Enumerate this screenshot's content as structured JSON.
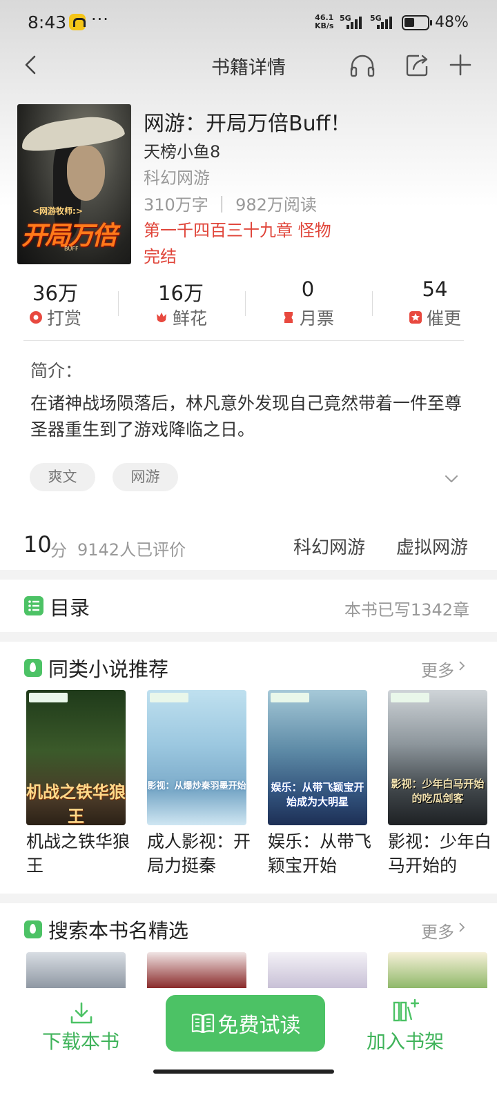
{
  "status_bar": {
    "time": "8:43",
    "more": "···",
    "speed": "46.1",
    "speed_unit": "KB/s",
    "signal1": "5G",
    "signal2": "5G",
    "battery": "48%"
  },
  "nav": {
    "title": "书籍详情",
    "icons": [
      "back-icon",
      "headphones-icon",
      "share-icon",
      "add-icon"
    ]
  },
  "book": {
    "cover_subtitle": "<网游牧师:>",
    "cover_title": "开局万倍",
    "cover_tag": "BUFF",
    "title": "网游：开局万倍Buff！",
    "author": "天榜小鱼8",
    "category": "科幻网游",
    "meta": "310万字 ｜ 982万阅读",
    "latest_chapter": "第一千四百三十九章 怪物",
    "status": "完结"
  },
  "stats": [
    {
      "value": "36万",
      "label": "打赏",
      "icon": "reward-icon"
    },
    {
      "value": "16万",
      "label": "鲜花",
      "icon": "flower-icon"
    },
    {
      "value": "0",
      "label": "月票",
      "icon": "ticket-icon"
    },
    {
      "value": "54",
      "label": "催更",
      "icon": "urge-icon"
    }
  ],
  "intro": {
    "label": "简介：",
    "text": "在诸神战场陨落后，林凡意外发现自己竟然带着一件至尊圣器重生到了游戏降临之日。",
    "tags": [
      "爽文",
      "网游"
    ]
  },
  "rating": {
    "score": "10",
    "unit": "分",
    "count": "9142人已评价",
    "categories": [
      "科幻网游",
      "虚拟网游"
    ]
  },
  "toc": {
    "label": "目录",
    "info": "本书已写1342章"
  },
  "similar": {
    "title": "同类小说推荐",
    "more": "更多",
    "books": [
      {
        "cover_text": "机战之铁华狼王",
        "name": "机战之铁华狼王"
      },
      {
        "cover_text": "影视：从爆炒秦羽墨开始",
        "name": "成人影视：开局力挺秦"
      },
      {
        "cover_text": "娱乐：从带飞颖宝开始成为大明星",
        "name": "娱乐：从带飞颖宝开始"
      },
      {
        "cover_text": "影视：少年白马开始的吃瓜剑客",
        "name": "影视：少年白马开始的"
      }
    ]
  },
  "search_pick": {
    "title": "搜索本书名精选",
    "more": "更多"
  },
  "bottom": {
    "download": "下载本书",
    "read": "免费试读",
    "shelf": "加入书架"
  },
  "colors": {
    "accent_green": "#4cc265",
    "chapter_red": "#e0453a",
    "reward_red": "#e8493f"
  }
}
